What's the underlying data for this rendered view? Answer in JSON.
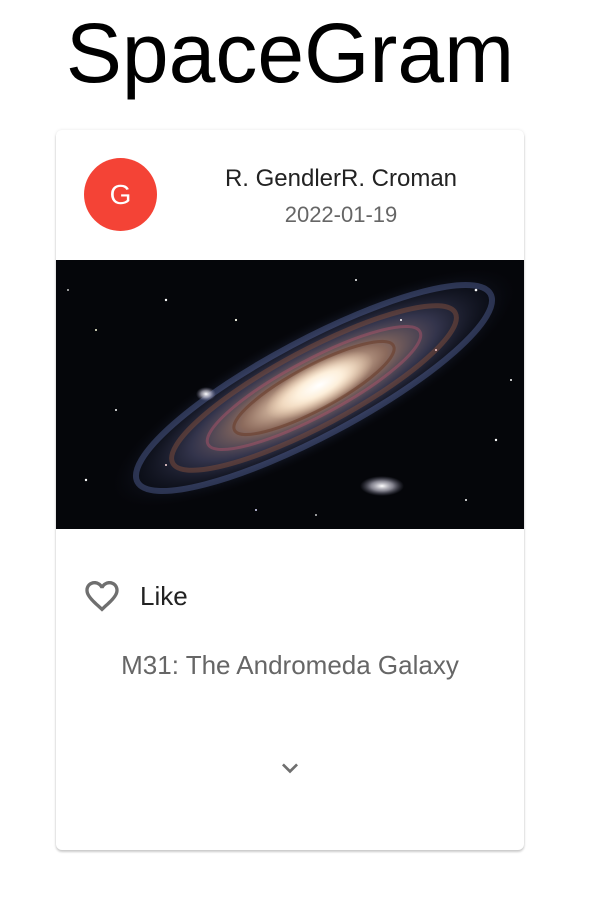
{
  "app": {
    "title": "SpaceGram"
  },
  "post": {
    "avatar_letter": "G",
    "avatar_color": "#f44336",
    "author": "R. GendlerR. Croman",
    "date": "2022-01-19",
    "image_subject": "Andromeda galaxy photograph",
    "like_label": "Like",
    "caption": "M31: The Andromeda Galaxy"
  },
  "icons": {
    "like": "heart-outline-icon",
    "expand": "chevron-down-icon"
  }
}
